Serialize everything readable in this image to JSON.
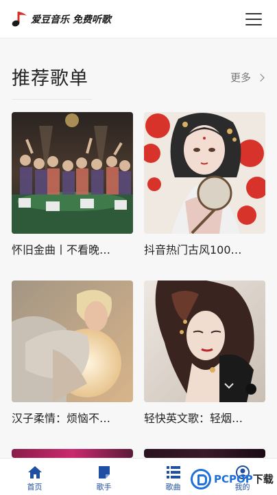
{
  "brand": {
    "name": "爱豆音乐",
    "slogan": "免费听歌"
  },
  "section": {
    "title": "推荐歌单",
    "more_label": "更多"
  },
  "playlists": [
    {
      "title": "怀旧金曲丨不看晚…"
    },
    {
      "title": "抖音热门古风100…"
    },
    {
      "title": "汉子柔情：烦恼不…"
    },
    {
      "title": "轻快英文歌：轻烟…"
    }
  ],
  "nav": [
    {
      "label": "首页",
      "icon": "home-icon"
    },
    {
      "label": "歌手",
      "icon": "singer-icon"
    },
    {
      "label": "歌曲",
      "icon": "song-list-icon"
    },
    {
      "label": "我的",
      "icon": "user-icon"
    }
  ],
  "watermark": {
    "brand": "PCPOP",
    "suffix": "下载"
  },
  "colors": {
    "accent": "#1e4fa3",
    "logo_note": "#d4302a"
  }
}
